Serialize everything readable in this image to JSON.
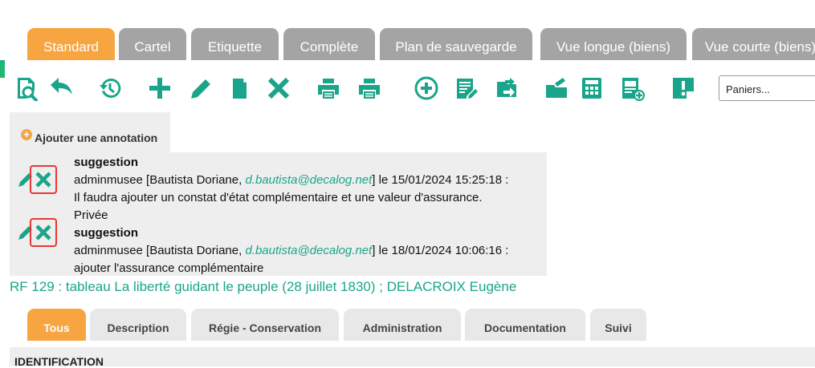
{
  "top_tabs": [
    {
      "label": "Standard",
      "active": true
    },
    {
      "label": "Cartel",
      "active": false
    },
    {
      "label": "Etiquette",
      "active": false
    },
    {
      "label": "Complète",
      "active": false
    },
    {
      "label": "Plan de sauvegarde",
      "active": false
    },
    {
      "label": "Vue longue (biens)",
      "active": false
    },
    {
      "label": "Vue courte (biens)",
      "active": false
    }
  ],
  "toolbar": {
    "icons": [
      "search-preview-icon",
      "undo-icon",
      "history-icon",
      "add-icon",
      "edit-icon",
      "copy-icon",
      "delete-icon",
      "print-icon",
      "print-alt-icon",
      "add-circle-icon",
      "list-edit-icon",
      "transfer-icon",
      "folder-export-icon",
      "calculator-icon",
      "document-add-icon",
      "alert-note-icon"
    ],
    "paniers_label": "Paniers..."
  },
  "annotations": {
    "add_label": "Ajouter une annotation",
    "notes": [
      {
        "title": "suggestion",
        "author_prefix": "adminmusee [Bautista Doriane, ",
        "email": "d.bautista@decalog.net",
        "author_suffix": "] le 15/01/2024 15:25:18 :",
        "body": "Il faudra ajouter un constat d'état complémentaire et une valeur d'assurance.",
        "privacy": "Privée"
      },
      {
        "title": "suggestion",
        "author_prefix": "adminmusee [Bautista Doriane, ",
        "email": "d.bautista@decalog.net",
        "author_suffix": "] le 18/01/2024 10:06:16 :",
        "body": "ajouter l'assurance complémentaire"
      }
    ]
  },
  "record_title": "RF 129 : tableau La liberté guidant le peuple (28 juillet 1830) ; DELACROIX Eugène",
  "section_tabs": [
    {
      "label": "Tous",
      "active": true
    },
    {
      "label": "Description",
      "active": false
    },
    {
      "label": "Régie - Conservation",
      "active": false
    },
    {
      "label": "Administration",
      "active": false
    },
    {
      "label": "Documentation",
      "active": false
    },
    {
      "label": "Suivi",
      "active": false
    }
  ],
  "section_header": "IDENTIFICATION",
  "colors": {
    "accent": "#f7a541",
    "green": "#1aa58a",
    "tab_gray": "#a4a4a4",
    "delete_border": "#e53935"
  }
}
